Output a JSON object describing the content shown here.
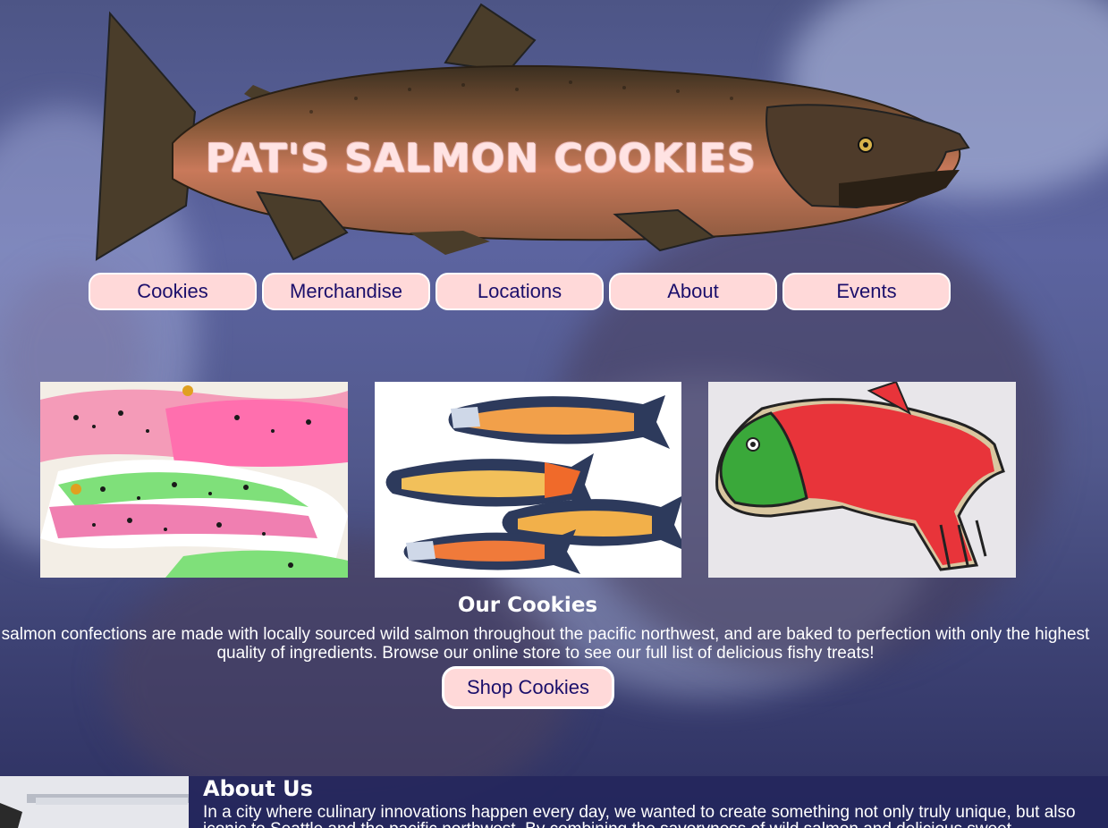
{
  "header": {
    "logo_text": "PAT'S SALMON COOKIES"
  },
  "nav": {
    "items": [
      {
        "label": "Cookies"
      },
      {
        "label": "Merchandise"
      },
      {
        "label": "Locations"
      },
      {
        "label": "About"
      },
      {
        "label": "Events"
      }
    ]
  },
  "gallery": {
    "photos": [
      {
        "icon": "rainbow-trout-cookies-photo"
      },
      {
        "icon": "arctic-char-cookies-photo"
      },
      {
        "icon": "red-salmon-cookie-photo"
      }
    ]
  },
  "cookies_section": {
    "title": "Our Cookies",
    "description": "salmon confections are made with locally sourced wild salmon throughout the pacific northwest, and are baked to perfection with only the highest quality of ingredients. Browse our online store to see our full list of delicious fishy treats!",
    "button_label": "Shop Cookies"
  },
  "about_section": {
    "title": "About Us",
    "description": "In a city where culinary innovations happen every day, we wanted to create something not only truly unique, but also iconic to Seattle and the pacific northwest. By combining the savoryness of wild salmon and delicious sweet"
  },
  "colors": {
    "button_bg": "#ffd9d9",
    "button_text": "#1b0f6b",
    "button_border": "#ffffff",
    "about_bg": "#23265c"
  }
}
